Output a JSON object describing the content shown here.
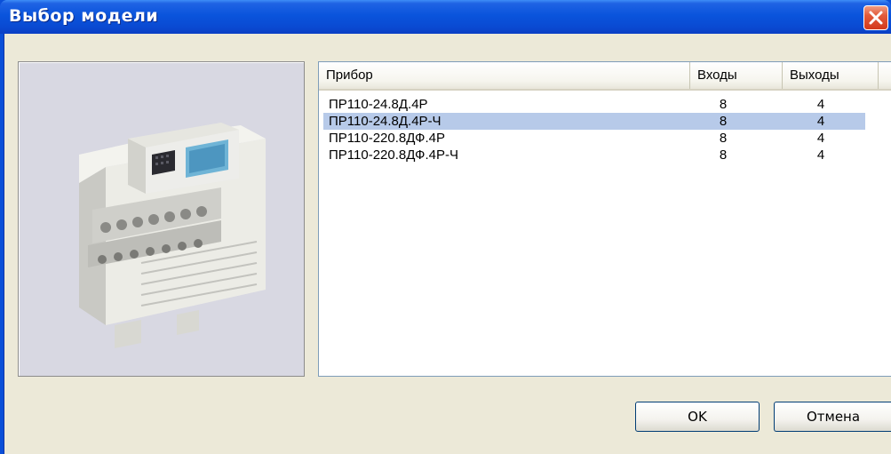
{
  "window": {
    "title": "Выбор модели"
  },
  "table": {
    "headers": {
      "device": "Прибор",
      "inputs": "Входы",
      "outputs": "Выходы"
    },
    "rows": [
      {
        "name": "ПР110-24.8Д.4Р",
        "inputs": "8",
        "outputs": "4",
        "selected": false
      },
      {
        "name": "ПР110-24.8Д.4Р-Ч",
        "inputs": "8",
        "outputs": "4",
        "selected": true
      },
      {
        "name": "ПР110-220.8ДФ.4Р",
        "inputs": "8",
        "outputs": "4",
        "selected": false
      },
      {
        "name": "ПР110-220.8ДФ.4Р-Ч",
        "inputs": "8",
        "outputs": "4",
        "selected": false
      }
    ]
  },
  "buttons": {
    "ok": "OK",
    "cancel": "Отмена"
  },
  "colors": {
    "titlebar": "#0a54dc",
    "dialog_bg": "#ece9d8",
    "selection": "#b7cae9",
    "close": "#d3391b"
  }
}
